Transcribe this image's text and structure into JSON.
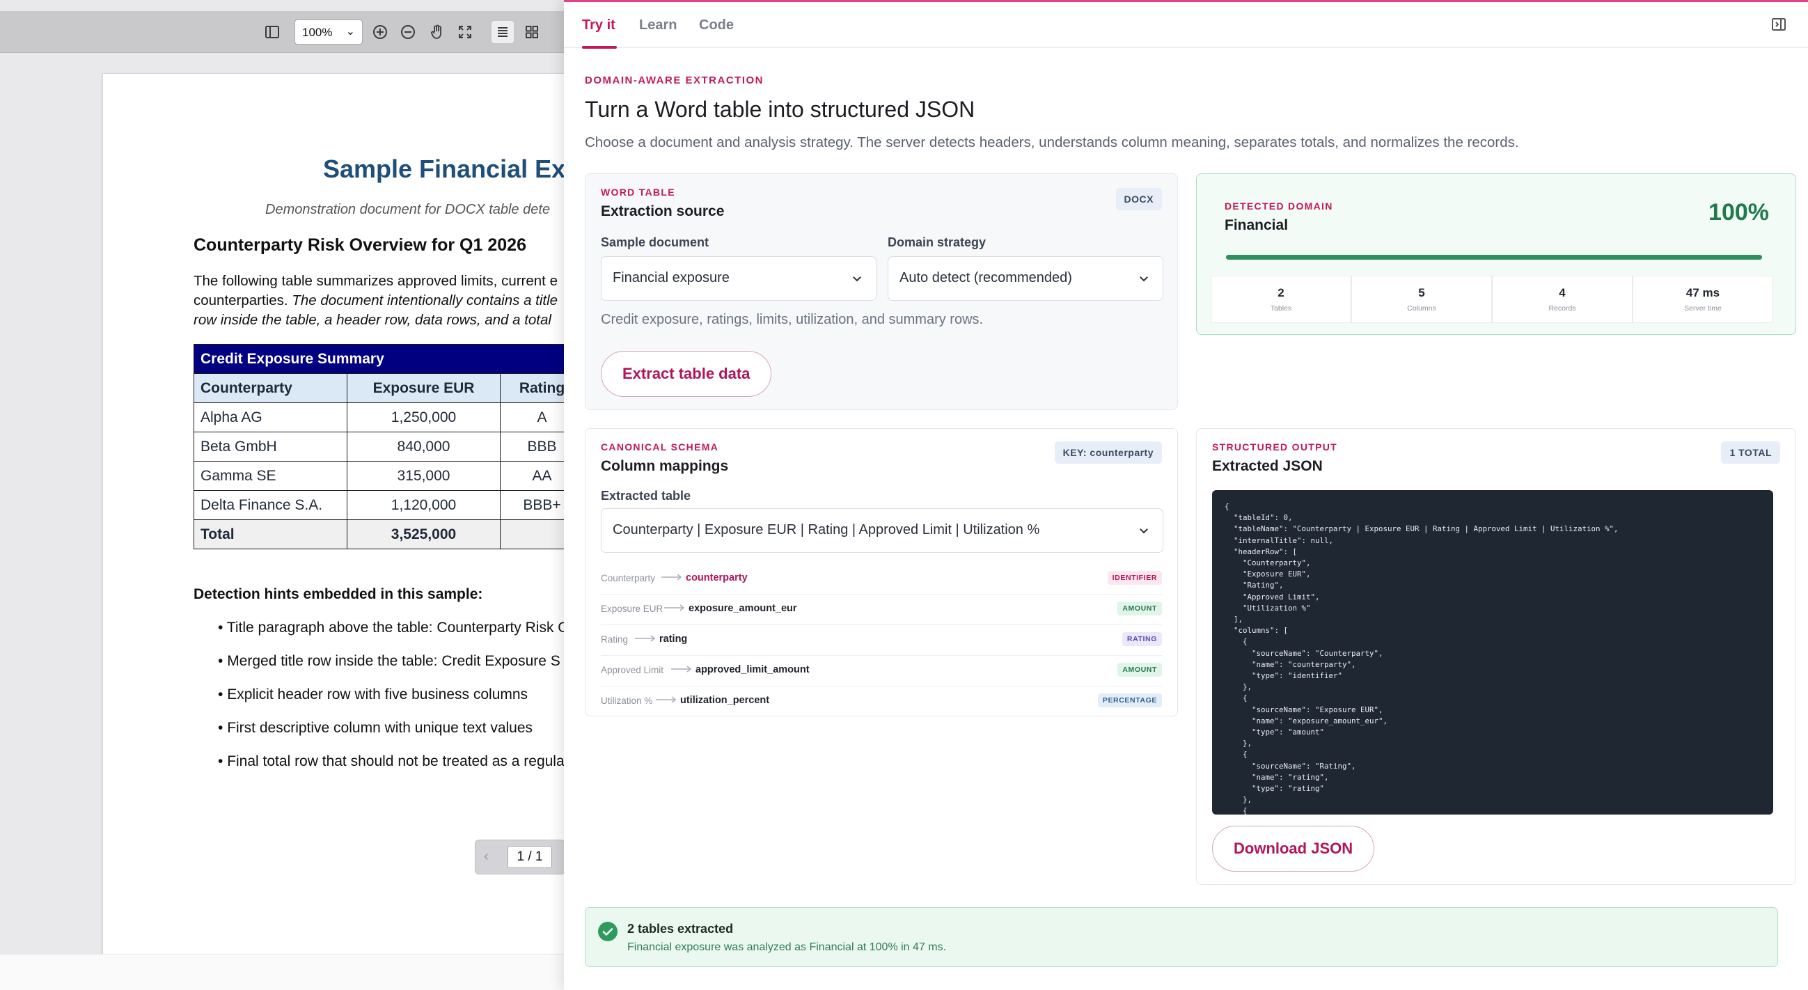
{
  "viewer": {
    "zoom": "100%",
    "page_indicator": "1 / 1",
    "document": {
      "title": "Sample Financial Ex",
      "subtitle": "Demonstration document for DOCX table dete",
      "heading": "Counterparty Risk Overview for Q1 2026",
      "para_line1": "The following table summarizes approved limits, current e",
      "para_line2_plain": "counterparties. ",
      "para_line2_italic": "The document intentionally contains a title",
      "para_line3_italic": "row inside the table, a header row, data rows, and a total",
      "table": {
        "merged_title": "Credit Exposure Summary",
        "headers": [
          "Counterparty",
          "Exposure EUR",
          "Rating"
        ],
        "rows": [
          [
            "Alpha AG",
            "1,250,000",
            "A"
          ],
          [
            "Beta GmbH",
            "840,000",
            "BBB"
          ],
          [
            "Gamma SE",
            "315,000",
            "AA"
          ],
          [
            "Delta Finance S.A.",
            "1,120,000",
            "BBB+"
          ]
        ],
        "total": [
          "Total",
          "3,525,000",
          ""
        ]
      },
      "hints_title": "Detection hints embedded in this sample:",
      "hints": [
        "Title paragraph above the table: Counterparty Risk O",
        "Merged title row inside the table: Credit Exposure S",
        "Explicit header row with five business columns",
        "First descriptive column with unique text values",
        "Final total row that should not be treated as a regula"
      ]
    }
  },
  "panel": {
    "tabs": [
      "Try it",
      "Learn",
      "Code"
    ],
    "eyebrow": "DOMAIN-AWARE EXTRACTION",
    "title": "Turn a Word table into structured JSON",
    "description": "Choose a document and analysis strategy. The server detects headers, understands column meaning, separates totals, and normalizes the records.",
    "source_card": {
      "eyebrow": "WORD TABLE",
      "title": "Extraction source",
      "chip": "DOCX",
      "sample_label": "Sample document",
      "sample_value": "Financial exposure",
      "strategy_label": "Domain strategy",
      "strategy_value": "Auto detect (recommended)",
      "hint": "Credit exposure, ratings, limits, utilization, and summary rows.",
      "extract_button": "Extract table data"
    },
    "domain_card": {
      "eyebrow": "DETECTED DOMAIN",
      "domain": "Financial",
      "percent_label": "100%",
      "confidence": 1.0,
      "stats": [
        {
          "value": "2",
          "label": "Tables"
        },
        {
          "value": "5",
          "label": "Columns"
        },
        {
          "value": "4",
          "label": "Records"
        },
        {
          "value": "47 ms",
          "label": "Server time"
        }
      ]
    },
    "schema_card": {
      "eyebrow": "CANONICAL SCHEMA",
      "title": "Column mappings",
      "chip": "KEY: counterparty",
      "table_label": "Extracted table",
      "table_value": "Counterparty | Exposure EUR | Rating | Approved Limit | Utilization %",
      "mappings": [
        {
          "source": "Counterparty",
          "target": "counterparty",
          "type": "IDENTIFIER"
        },
        {
          "source": "Exposure EUR",
          "target": "exposure_amount_eur",
          "type": "AMOUNT"
        },
        {
          "source": "Rating",
          "target": "rating",
          "type": "RATING"
        },
        {
          "source": "Approved Limit",
          "target": "approved_limit_amount",
          "type": "AMOUNT"
        },
        {
          "source": "Utilization %",
          "target": "utilization_percent",
          "type": "PERCENTAGE"
        }
      ]
    },
    "output_card": {
      "eyebrow": "STRUCTURED OUTPUT",
      "title": "Extracted JSON",
      "chip": "1 TOTAL",
      "json_preview": "{\n  \"tableId\": 0,\n  \"tableName\": \"Counterparty | Exposure EUR | Rating | Approved Limit | Utilization %\",\n  \"internalTitle\": null,\n  \"headerRow\": [\n    \"Counterparty\",\n    \"Exposure EUR\",\n    \"Rating\",\n    \"Approved Limit\",\n    \"Utilization %\"\n  ],\n  \"columns\": [\n    {\n      \"sourceName\": \"Counterparty\",\n      \"name\": \"counterparty\",\n      \"type\": \"identifier\"\n    },\n    {\n      \"sourceName\": \"Exposure EUR\",\n      \"name\": \"exposure_amount_eur\",\n      \"type\": \"amount\"\n    },\n    {\n      \"sourceName\": \"Rating\",\n      \"name\": \"rating\",\n      \"type\": \"rating\"\n    },\n    {",
      "download_button": "Download JSON"
    },
    "success": {
      "title": "2 tables extracted",
      "description": "Financial exposure was analyzed as Financial at 100% in 47 ms."
    }
  }
}
